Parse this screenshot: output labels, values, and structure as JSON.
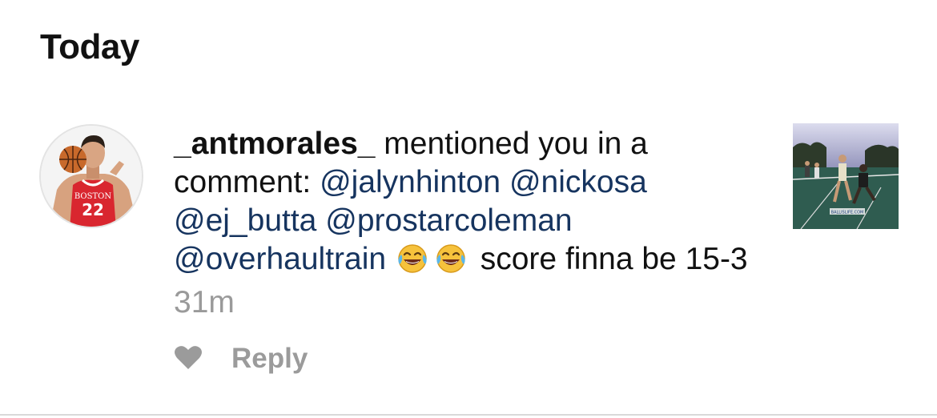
{
  "section": {
    "title": "Today"
  },
  "notification": {
    "username": "_antmorales_",
    "action_text": " mentioned you in a comment: ",
    "mentions": [
      "@jalynhinton",
      "@nickosa",
      "@ej_butta",
      "@prostarcoleman",
      "@overhaultrain"
    ],
    "emojis": [
      "face-with-tears-of-joy-icon",
      "face-with-tears-of-joy-icon"
    ],
    "comment_text": " score finna be 15-3",
    "timestamp": "31m",
    "avatar_jersey_team": "BOSTON",
    "avatar_jersey_number": "22",
    "thumbnail_watermark": "BALLISLIFE.COM"
  },
  "actions": {
    "like_icon": "heart-icon",
    "reply_label": "Reply"
  },
  "colors": {
    "mention": "#16345f",
    "muted": "#9b9b9b",
    "divider": "#d9d9d9"
  }
}
